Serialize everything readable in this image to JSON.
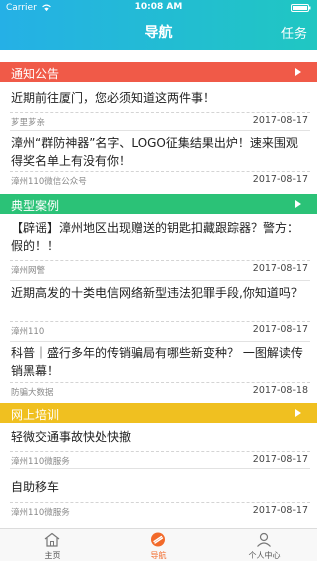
{
  "status_bar": {
    "carrier": "Carrier",
    "time": "10:08 AM"
  },
  "nav": {
    "title": "导航",
    "right_action": "任务"
  },
  "sections": [
    {
      "title": "通知公告",
      "items": [
        {
          "title": "近期前往厦门，您必须知道这两件事！",
          "source": "芗里芗亲",
          "date": "2017-08-17"
        },
        {
          "title": "漳州“群防神器”名字、LOGO征集结果出炉！速来围观得奖名单上有没有你！",
          "source": "漳州110微信公众号",
          "date": "2017-08-17"
        }
      ]
    },
    {
      "title": "典型案例",
      "items": [
        {
          "title": "【辟谣】漳州地区出现赠送的钥匙扣藏跟踪器？警方：假的！！",
          "source": "漳州网警",
          "date": "2017-08-17"
        },
        {
          "title": "近期高发的十类电信网络新型违法犯罪手段,你知道吗？",
          "source": "漳州110",
          "date": "2017-08-17"
        },
        {
          "title": "科普｜盛行多年的传销骗局有哪些新变种？ 一图解读传销黑幕！",
          "source": "防骗大数据",
          "date": "2017-08-18"
        }
      ]
    },
    {
      "title": "网上培训",
      "items": [
        {
          "title": "轻微交通事故快处快撤",
          "source": "漳州110微服务",
          "date": "2017-08-17"
        },
        {
          "title": "自助移车",
          "source": "漳州110微服务",
          "date": "2017-08-17"
        }
      ]
    }
  ],
  "tabbar": [
    {
      "label": "主页",
      "icon": "home-icon",
      "active": false
    },
    {
      "label": "导航",
      "icon": "navigation-icon",
      "active": true
    },
    {
      "label": "个人中心",
      "icon": "person-icon",
      "active": false
    }
  ],
  "colors": {
    "header_gradient_start": "#25b0e6",
    "header_gradient_end": "#20c7c2",
    "notice_section": "#f05a48",
    "case_section": "#2bc277",
    "training_section": "#f0c020",
    "active_tab": "#f26a2a"
  }
}
